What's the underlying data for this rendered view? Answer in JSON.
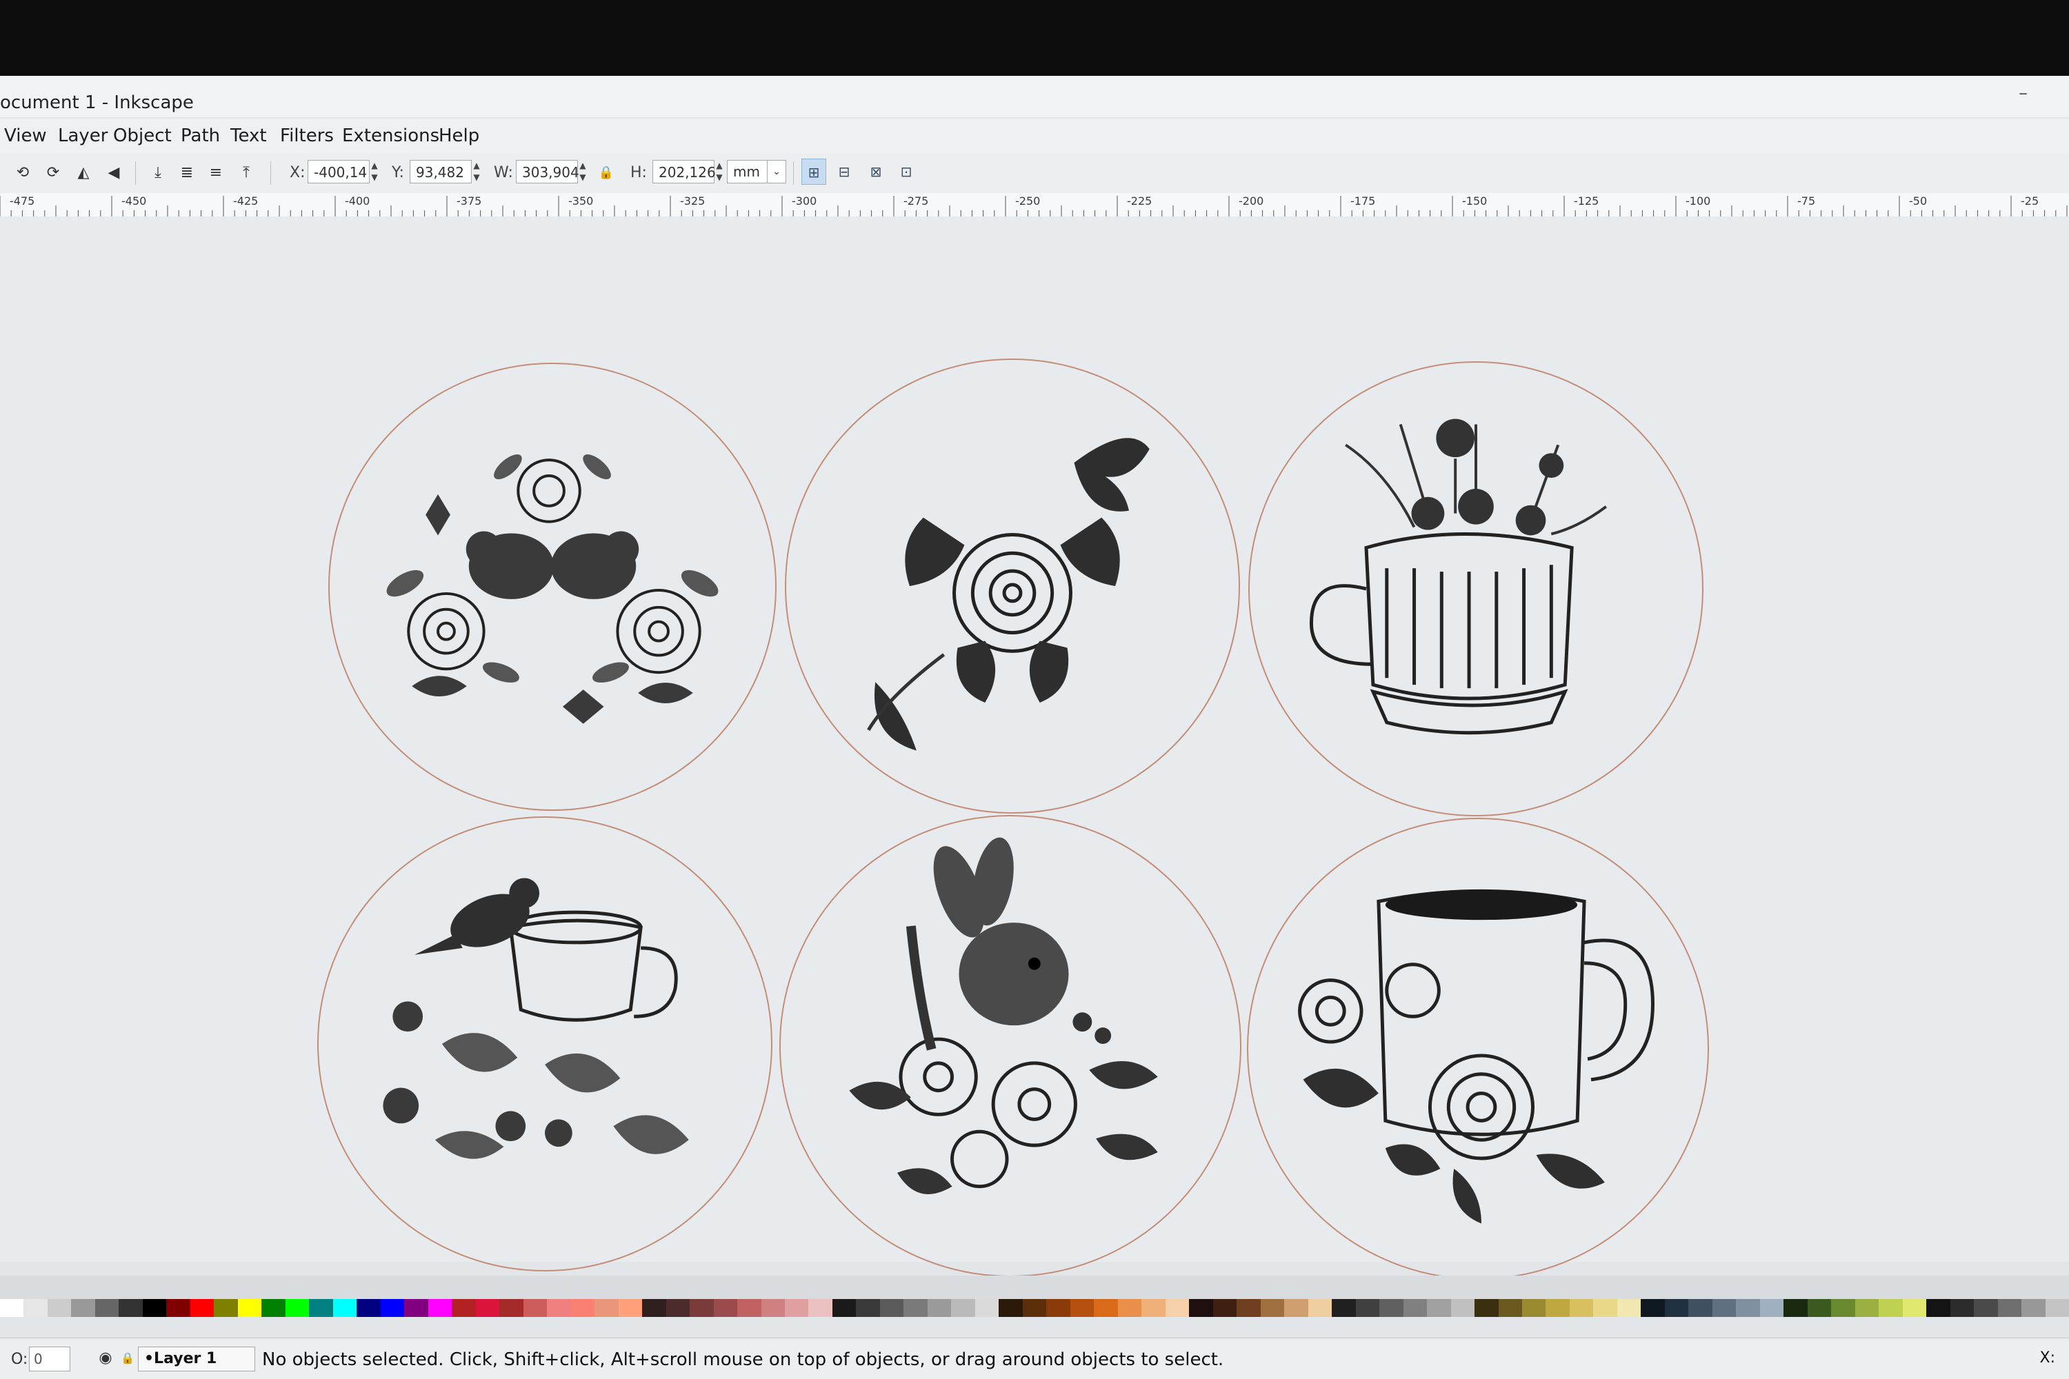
{
  "window": {
    "title": "ocument 1 - Inkscape",
    "minimize_symbol": "–"
  },
  "menu": [
    "View",
    "Layer",
    "Object",
    "Path",
    "Text",
    "Filters",
    "Extensions",
    "Help"
  ],
  "toolbar": {
    "x_label": "X:",
    "x_value": "-400,14",
    "y_label": "Y:",
    "y_value": "93,482",
    "w_label": "W:",
    "w_value": "303,904",
    "h_label": "H:",
    "h_value": "202,126",
    "unit": "mm",
    "lock_icon": "lock-icon"
  },
  "ruler": {
    "labels": [
      "-475",
      "-450",
      "-425",
      "-400",
      "-375",
      "-350",
      "-325",
      "-300",
      "-275",
      "-250",
      "-225",
      "-200",
      "-175",
      "-150",
      "-125",
      "-100",
      "-75",
      "-50",
      "-25"
    ]
  },
  "canvas": {
    "coasters": [
      {
        "name": "coaster-birds-roses",
        "subject": "two-birds-with-roses-and-butterflies"
      },
      {
        "name": "coaster-rose-butterfly",
        "subject": "rose-with-butterflies"
      },
      {
        "name": "coaster-teacup-wildflowers",
        "subject": "teacup-with-wildflowers"
      },
      {
        "name": "coaster-goldfinch-teacup",
        "subject": "goldfinch-on-teacup-with-berries"
      },
      {
        "name": "coaster-rabbit-flowers",
        "subject": "rabbit-among-flowers"
      },
      {
        "name": "coaster-coffee-mug-roses",
        "subject": "coffee-mug-with-roses"
      }
    ],
    "outline_color": "#c48d78"
  },
  "palette": [
    "#ffffff",
    "#e6e6e6",
    "#cccccc",
    "#999999",
    "#666666",
    "#333333",
    "#000000",
    "#800000",
    "#ff0000",
    "#808000",
    "#ffff00",
    "#008000",
    "#00ff00",
    "#008080",
    "#00ffff",
    "#000080",
    "#0000ff",
    "#800080",
    "#ff00ff",
    "#b22222",
    "#dc143c",
    "#a52a2a",
    "#cd5c5c",
    "#f08080",
    "#fa8072",
    "#e9967a",
    "#ffa07a",
    "#2f1f1f",
    "#4b2b2b",
    "#7a3b3b",
    "#9b4b4b",
    "#c06060",
    "#d08080",
    "#e0a0a0",
    "#ebc0c0",
    "#1a1a1a",
    "#3a3a3a",
    "#5a5a5a",
    "#7a7a7a",
    "#9a9a9a",
    "#bababa",
    "#dadada",
    "#2b1a0a",
    "#5c2e0a",
    "#8b3a0a",
    "#b5500f",
    "#d96a1a",
    "#e8904a",
    "#f0b07a",
    "#f5d0a8",
    "#1f0f0f",
    "#3f1f0f",
    "#6f3f1f",
    "#9f6f3f",
    "#cf9f6f",
    "#efcf9f",
    "#202020",
    "#404040",
    "#606060",
    "#808080",
    "#a0a0a0",
    "#c0c0c0",
    "#3a3010",
    "#6a5a20",
    "#9a8a30",
    "#c0a840",
    "#d8c060",
    "#e8d888",
    "#f0e8b0",
    "#101820",
    "#203040",
    "#405060",
    "#607080",
    "#8090a0",
    "#a0b0c0",
    "#1a2a10",
    "#3a5a20",
    "#6a8a30",
    "#9ab040",
    "#c0d050",
    "#e0e870",
    "#141414",
    "#2c2c2c",
    "#4a4a4a",
    "#6e6e6e",
    "#989898",
    "#c4c4c4"
  ],
  "status": {
    "o_label": "O:",
    "o_value": "0",
    "layer": "•Layer 1",
    "message": "No objects selected. Click, Shift+click, Alt+scroll mouse on top of objects, or drag around objects to select.",
    "x_label": "X:"
  }
}
